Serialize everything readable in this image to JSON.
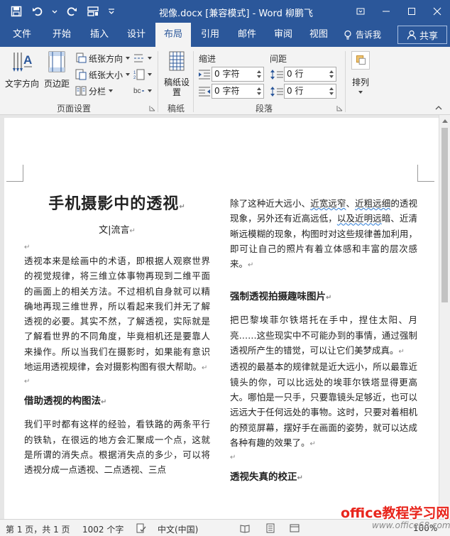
{
  "window": {
    "title": "视像.docx [兼容模式] - Word",
    "user": "柳鹏飞"
  },
  "tabs": [
    "文件",
    "开始",
    "插入",
    "设计",
    "布局",
    "引用",
    "邮件",
    "审阅",
    "视图"
  ],
  "active_tab": "布局",
  "tell_me": "告诉我",
  "share": "共享",
  "ribbon": {
    "page_setup": {
      "label": "页面设置",
      "text_direction": "文字方向",
      "margins": "页边距",
      "orientation": "纸张方向",
      "size": "纸张大小",
      "columns": "分栏"
    },
    "draft": {
      "label": "稿纸",
      "draft_setup": "稿纸设置"
    },
    "paragraph": {
      "label": "段落",
      "indent_label": "缩进",
      "spacing_label": "间距",
      "indent_left": "0 字符",
      "indent_right": "0 字符",
      "space_before": "0 行",
      "space_after": "0 行"
    },
    "arrange": {
      "label": "排列"
    }
  },
  "document": {
    "title": "手机摄影中的透视",
    "author": "文|流言",
    "left_col": {
      "p1": "透视本来是绘画中的术语，即根据人观察世界的视觉规律，将三维立体事物再现到二维平面的画面上的相关方法。不过相机自身就可以精确地再现三维世界，所以看起来我们并无了解透视的必要。其实不然，了解透视，实际就是了解看世界的不同角度，毕竟相机还是要靠人来操作。所以当我们在摄影时，如果能有意识地运用透视规律，会对摄影构图有很大帮助。",
      "h2": "借助透视的构图法",
      "p2": "我们平时都有这样的经验，看铁路的两条平行的铁轨，在很远的地方会汇聚成一个点，这就是所谓的消失点。根据消失点的多少，可以将透视分成一点透视、二点透视、三点"
    },
    "right_col": {
      "p1_a": "除了这种近大远小、",
      "p1_w1": "近宽远窄",
      "p1_b": "、",
      "p1_w2": "近粗远细",
      "p1_c": "的透视现象，另外还有近高远低，",
      "p1_w3": "以及近明远",
      "p1_d": "暗、近清晰远模糊的现象，构图时对这些规律善加利用，即可让自己的照片有着立体感和丰富的层次感来。",
      "h2a": "强制透视拍摄趣味图片",
      "p2": "把巴黎埃菲尔铁塔托在手中，捏住太阳、月亮……这些现实中不可能办到的事情，通过强制透视所产生的错觉，可以让它们美梦成真。",
      "p3": "透视的最基本的规律就是近大远小，所以最靠近镜头的你，可以比远处的埃菲尔铁塔显得更高大。哪怕是一只手，只要靠镜头足够近，也可以远远大于任何远处的事物。这时，只要对着相机的预览屏幕，摆好手在画面的姿势，就可以达成各种有趣的效果了。",
      "h2b": "透视失真的校正"
    }
  },
  "status": {
    "page": "第 1 页，共 1 页",
    "words": "1002 个字",
    "language": "中文(中国)",
    "zoom": "100%"
  },
  "watermark": {
    "line1": "office教程学习网",
    "line2": "www.office68.com"
  },
  "colors": {
    "accent": "#2b579a",
    "ribbon_bg": "#f3f3f3",
    "canvas_bg": "#e6e6e6"
  }
}
